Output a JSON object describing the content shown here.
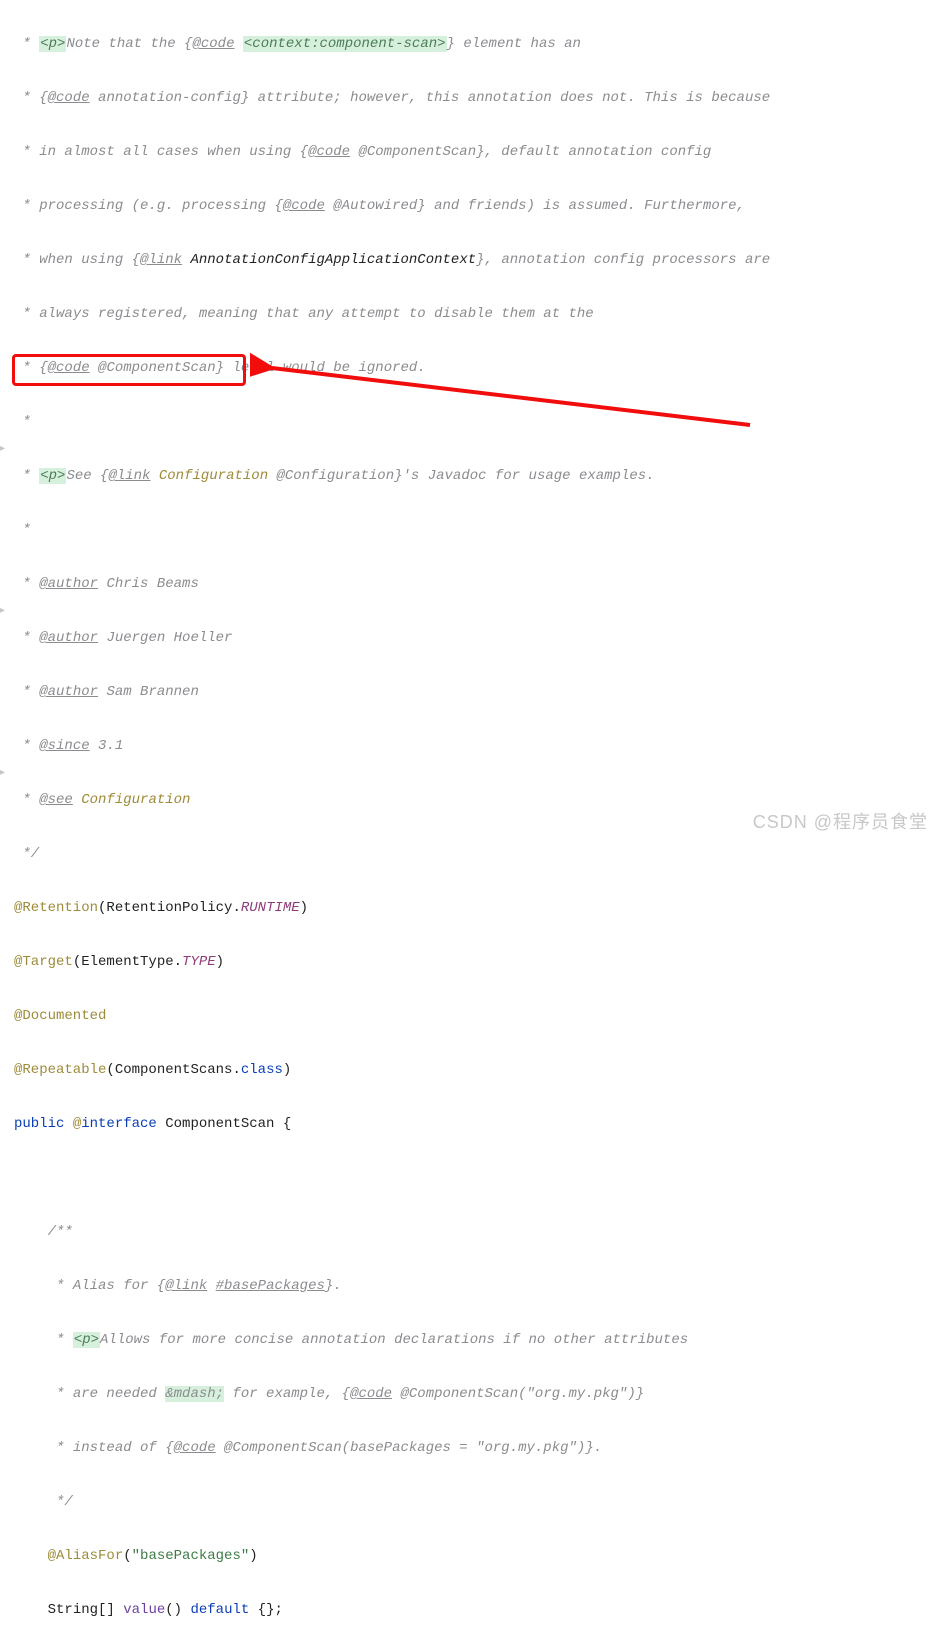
{
  "doc": {
    "p1": {
      "open": "<p>",
      "t1": "Note that the {",
      "code1_tag": "@code",
      "code1_val": "<context:component-scan>",
      "t2": "} element has an"
    },
    "p2": {
      "t1": "{",
      "code_tag": "@code",
      "t2": " annotation-config} attribute; however, this annotation does not. This is because"
    },
    "p3": {
      "t1": "in almost all cases when using {",
      "code_tag": "@code",
      "t2": " @ComponentScan}, default annotation config"
    },
    "p4": {
      "t1": "processing (e.g. processing {",
      "code_tag": "@code",
      "t2": " @Autowired} and friends) is assumed. Furthermore,"
    },
    "p5": {
      "t1": "when using {",
      "link_tag": "@link",
      "cls": "AnnotationConfigApplicationContext",
      "t2": "}, annotation config processors are"
    },
    "p6": "always registered, meaning that any attempt to disable them at the",
    "p7": {
      "t1": "{",
      "code_tag": "@code",
      "t2": " @ComponentScan} level would be ignored."
    },
    "p8": {
      "open": "<p>",
      "t1": "See {",
      "link_tag": "@link",
      "cfg": "Configuration",
      "t2": " @Configuration}'s Javadoc for usage examples."
    },
    "authors": {
      "tag": "@author",
      "a1": "Chris Beams",
      "a2": "Juergen Hoeller",
      "a3": "Sam Brannen"
    },
    "since": {
      "tag": "@since",
      "val": "3.1"
    },
    "see": {
      "tag": "@see",
      "val": "Configuration"
    }
  },
  "code": {
    "retention": {
      "anno": "@Retention",
      "open": "(",
      "cls": "RetentionPolicy",
      "dot": ".",
      "enm": "RUNTIME",
      "close": ")"
    },
    "target": {
      "anno": "@Target",
      "open": "(",
      "cls": "ElementType",
      "dot": ".",
      "enm": "TYPE",
      "close": ")"
    },
    "documented": "@Documented",
    "repeatable": {
      "anno": "@Repeatable",
      "open": "(",
      "cls": "ComponentScans",
      "dot": ".",
      "kw": "class",
      "close": ")"
    },
    "decl": {
      "pub": "public ",
      "at": "@",
      "intf": "interface ",
      "name": "ComponentScan",
      "brace": " {"
    }
  },
  "inner": {
    "l1": {
      "t1": "Alias for {",
      "link": "@link",
      "bp": "#basePackages",
      "t2": "}."
    },
    "l2": {
      "open": "<p>",
      "t": "Allows for more concise annotation declarations if no other attributes"
    },
    "l3": {
      "t1": "are needed ",
      "md": "&mdash;",
      "t2": " for example, {",
      "code": "@code",
      "t3": " @ComponentScan(\"org.my.pkg\")}"
    },
    "l4": {
      "t1": "instead of {",
      "code": "@code",
      "t2": " @ComponentScan(basePackages = \"org.my.pkg\")}."
    },
    "alias": {
      "anno": "@AliasFor",
      "open": "(",
      "str": "\"basePackages\"",
      "close": ")"
    },
    "method": {
      "ret": "String[] ",
      "name": "value",
      "sig": "() ",
      "def": "default",
      "body": " {};"
    }
  },
  "watermark": "CSDN @程序员食堂"
}
